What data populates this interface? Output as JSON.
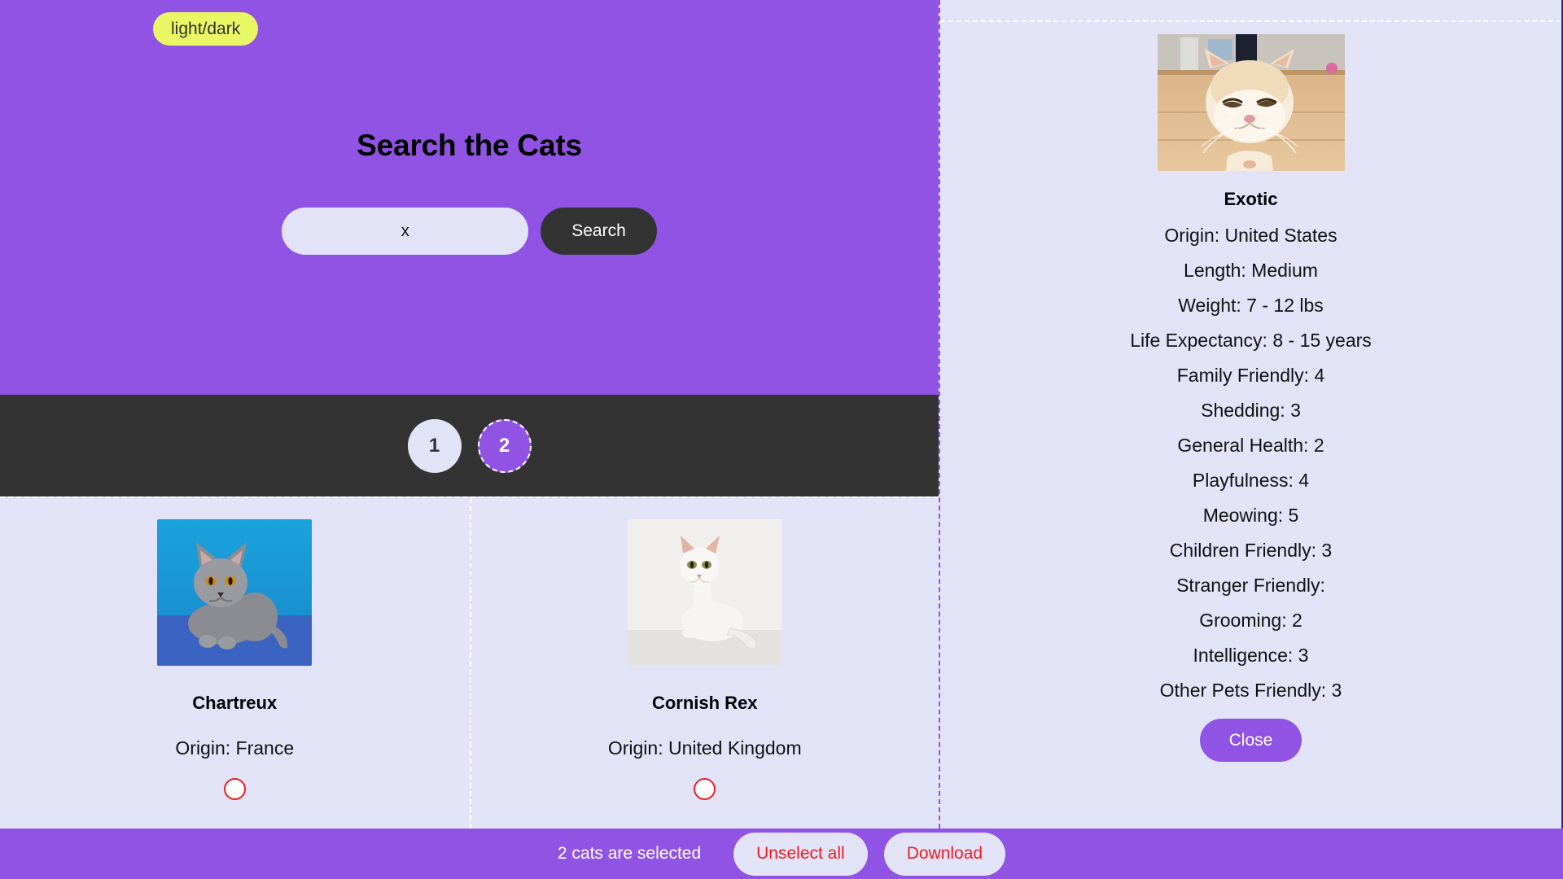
{
  "theme": {
    "toggle_label": "light/dark",
    "accent_purple": "#9053e3",
    "panel_bg": "#e2e3f7",
    "dark_bar": "#333333",
    "toggle_yellow": "#eaf764",
    "danger_red": "#ee1d23"
  },
  "hero": {
    "title": "Search the Cats",
    "search_value": "x",
    "search_placeholder": "",
    "search_button_label": "Search"
  },
  "pagination": {
    "pages": [
      {
        "label": "1",
        "active": false
      },
      {
        "label": "2",
        "active": true
      }
    ]
  },
  "cats": [
    {
      "name": "Chartreux",
      "origin_line": "Origin: France",
      "photo": "chartreux-kitten-blue-backdrop",
      "selected": false
    },
    {
      "name": "Cornish Rex",
      "origin_line": "Origin: United Kingdom",
      "photo": "cornish-rex-white-cat",
      "selected": false
    }
  ],
  "footer": {
    "status": "2 cats are selected",
    "unselect_label": "Unselect all",
    "download_label": "Download"
  },
  "detail": {
    "photo": "exotic-shorthair-cream-cat",
    "name": "Exotic",
    "rows": [
      "Origin: United States",
      "Length: Medium",
      "Weight: 7 - 12 lbs",
      "Life Expectancy: 8 - 15 years",
      "Family Friendly: 4",
      "Shedding: 3",
      "General Health: 2",
      "Playfulness: 4",
      "Meowing: 5",
      "Children Friendly: 3",
      "Stranger Friendly:",
      "Grooming: 2",
      "Intelligence: 3",
      "Other Pets Friendly: 3"
    ],
    "close_label": "Close"
  }
}
